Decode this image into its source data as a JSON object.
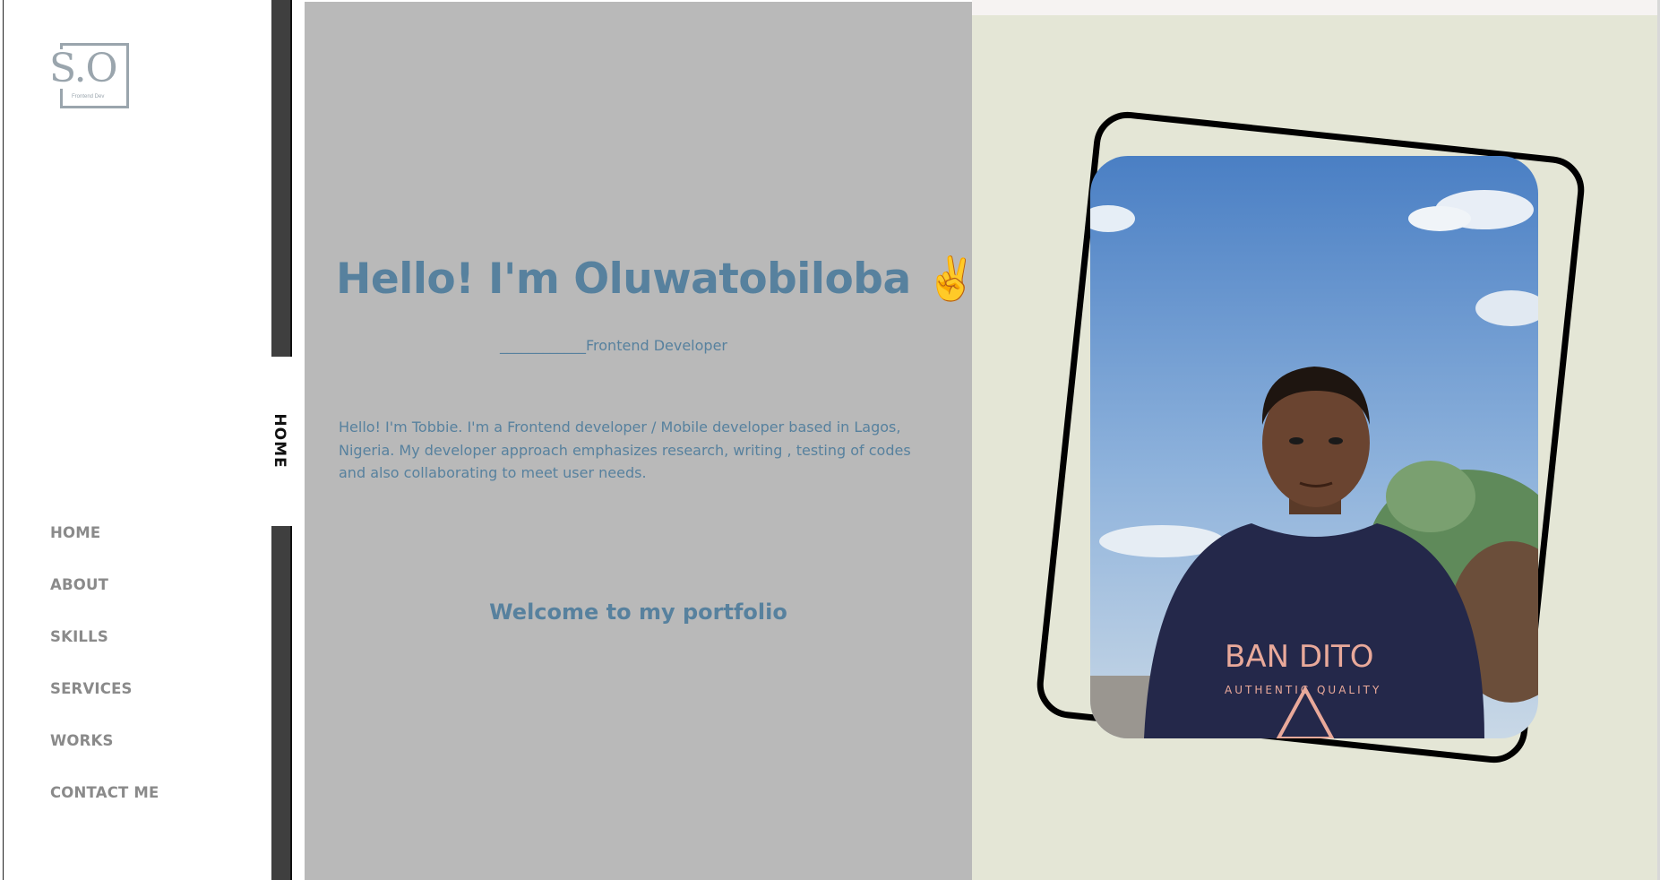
{
  "logo": {
    "letters": "S.O",
    "subtitle": "Frontend Dev"
  },
  "nav": {
    "items": [
      "HOME",
      "ABOUT",
      "SKILLS",
      "SERVICES",
      "WORKS",
      "CONTACT ME"
    ],
    "active_tab": "HOME"
  },
  "hero": {
    "greeting": "Hello! I'm Oluwatobiloba",
    "emoji": "✌️",
    "role": "____________Frontend Developer",
    "bio": "Hello! I'm Tobbie. I'm a Frontend developer / Mobile developer based in Lagos, Nigeria. My developer approach emphasizes research, writing , testing of codes and also collaborating to meet user needs.",
    "welcome": "Welcome to my portfolio"
  },
  "photo": {
    "shirt_text_1": "BAN DITO",
    "shirt_text_2": "AUTHENTIC QUALITY"
  },
  "colors": {
    "accent_text": "#57819e",
    "center_bg": "#b9b9b9",
    "right_bg": "#e4e6d6",
    "nav_text": "#8a8a8a",
    "strip": "#3f3f3f"
  },
  "icons": {
    "peace": "victory-hand-icon"
  }
}
